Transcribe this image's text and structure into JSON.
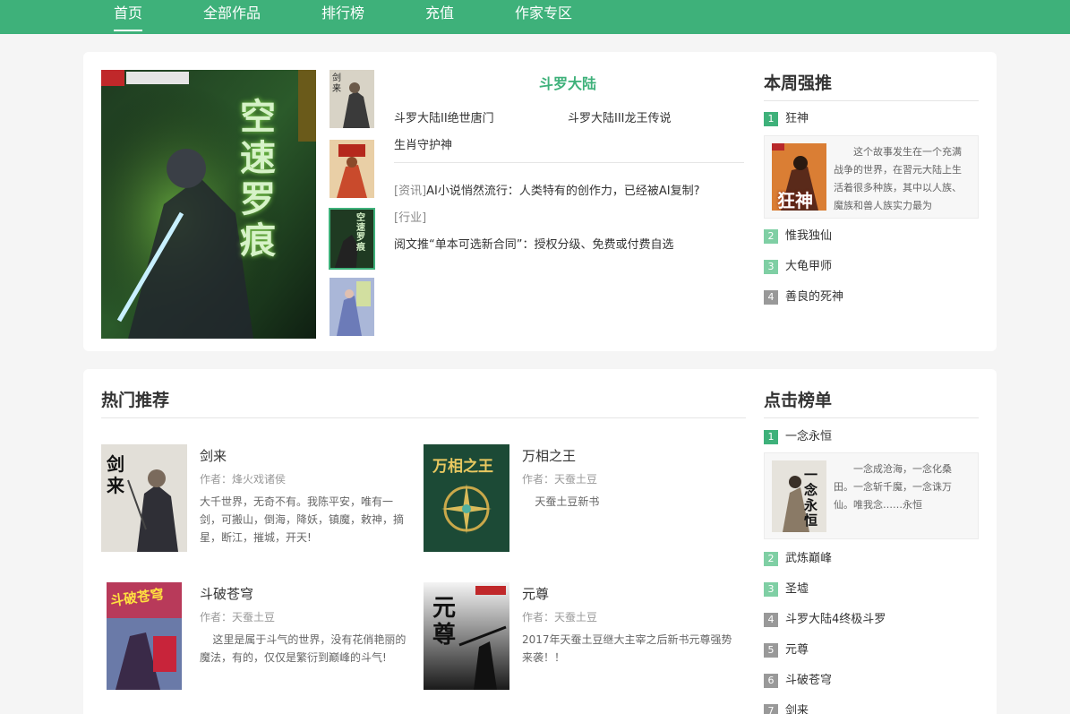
{
  "nav": {
    "items": [
      {
        "label": "首页",
        "active": true
      },
      {
        "label": "全部作品"
      },
      {
        "label": "排行榜"
      },
      {
        "label": "充值"
      },
      {
        "label": "作家专区"
      }
    ]
  },
  "featured": {
    "title": "斗罗大陆",
    "links": [
      "斗罗大陆II绝世唐门",
      "斗罗大陆III龙王传说",
      "生肖守护神"
    ],
    "news": [
      {
        "tag": "[资讯]",
        "text": "AI小说悄然流行：人类特有的创作力，已经被AI复制?"
      },
      {
        "tag": "[行业]",
        "text": ""
      },
      {
        "tag": "",
        "text": "阅文推“单本可选新合同”：授权分级、免费或付费自选"
      }
    ]
  },
  "weekly": {
    "title": "本周强推",
    "items": [
      {
        "num": "1",
        "label": "狂神"
      },
      {
        "num": "2",
        "label": "惟我独仙"
      },
      {
        "num": "3",
        "label": "大龟甲师"
      },
      {
        "num": "4",
        "label": "善良的死神"
      }
    ],
    "top_desc": "这个故事发生在一个充满战争的世界，在習元大陆上生活着很多种族，其中以人族、魔族和兽人族实力最为"
  },
  "hot": {
    "title": "热门推荐",
    "books": [
      {
        "title": "剑来",
        "author": "作者：烽火戏诸侯",
        "desc": "大千世界，无奇不有。我陈平安，唯有一剑，可搬山，倒海，降妖，镇魔，敕神，摘星，断江，摧城，开天!"
      },
      {
        "title": "万相之王",
        "author": "作者：天蚕土豆",
        "desc": "天蚕土豆新书"
      },
      {
        "title": "斗破苍穹",
        "author": "作者：天蚕土豆",
        "desc": "这里是属于斗气的世界，没有花俏艳丽的魔法，有的，仅仅是繁衍到巅峰的斗气!"
      },
      {
        "title": "元尊",
        "author": "作者：天蚕土豆",
        "desc": "2017年天蚕土豆继大主宰之后新书元尊强势来袭！！"
      }
    ]
  },
  "clicks": {
    "title": "点击榜单",
    "items": [
      {
        "num": "1",
        "label": "一念永恒"
      },
      {
        "num": "2",
        "label": "武炼巅峰"
      },
      {
        "num": "3",
        "label": "圣墟"
      },
      {
        "num": "4",
        "label": "斗罗大陆4终极斗罗"
      },
      {
        "num": "5",
        "label": "元尊"
      },
      {
        "num": "6",
        "label": "斗破苍穹"
      },
      {
        "num": "7",
        "label": "剑来"
      }
    ],
    "top_desc": "一念成沧海，一念化桑田。一念斩千魔，一念诛万仙。唯我念……永恒"
  },
  "cover_text": {
    "main": "空速罗痕",
    "thumb1": "剑来",
    "thumb3": "空速罗痕",
    "kuangshen": "狂神",
    "yinian": "一念永恒",
    "wanxiang": "万相之王",
    "doupo": "斗破苍穹",
    "yuanzun": "元尊"
  },
  "colors": {
    "brand": "#3eb17a",
    "rank_top": "#3eb17a",
    "rank_mid": "#7fcfa4",
    "rank_low": "#999999"
  }
}
